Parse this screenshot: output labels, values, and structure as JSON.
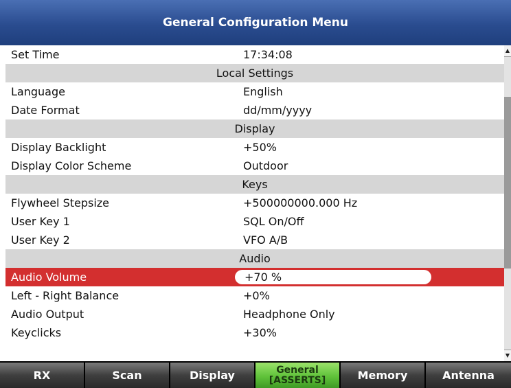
{
  "window": {
    "title": "General Configuration Menu"
  },
  "menu": {
    "rows": [
      {
        "type": "item",
        "label": "Set Time",
        "value": "17:34:08"
      },
      {
        "type": "section",
        "label": "Local Settings"
      },
      {
        "type": "item",
        "label": "Language",
        "value": "English"
      },
      {
        "type": "item",
        "label": "Date Format",
        "value": "dd/mm/yyyy"
      },
      {
        "type": "section",
        "label": "Display"
      },
      {
        "type": "item",
        "label": "Display Backlight",
        "value": "+50%"
      },
      {
        "type": "item",
        "label": "Display Color Scheme",
        "value": "Outdoor"
      },
      {
        "type": "section",
        "label": "Keys"
      },
      {
        "type": "item",
        "label": "Flywheel Stepsize",
        "value": "+500000000.000 Hz"
      },
      {
        "type": "item",
        "label": "User Key 1",
        "value": "SQL On/Off"
      },
      {
        "type": "item",
        "label": "User Key 2",
        "value": "VFO A/B"
      },
      {
        "type": "section",
        "label": "Audio"
      },
      {
        "type": "item",
        "label": "Audio Volume",
        "value": "+70 %",
        "selected": true
      },
      {
        "type": "item",
        "label": "Left - Right Balance",
        "value": "+0%"
      },
      {
        "type": "item",
        "label": "Audio Output",
        "value": "Headphone Only"
      },
      {
        "type": "item",
        "label": "Keyclicks",
        "value": "+30%"
      }
    ]
  },
  "softkeys": [
    {
      "label": "RX"
    },
    {
      "label": "Scan"
    },
    {
      "label": "Display"
    },
    {
      "label": "General",
      "sublabel": "[ASSERTS]",
      "active": true
    },
    {
      "label": "Memory"
    },
    {
      "label": "Antenna"
    }
  ],
  "colors": {
    "title_bar": "#2a4c8f",
    "selected_row": "#d32f2f",
    "section_row": "#d6d6d6",
    "active_softkey": "#5fc23a"
  }
}
